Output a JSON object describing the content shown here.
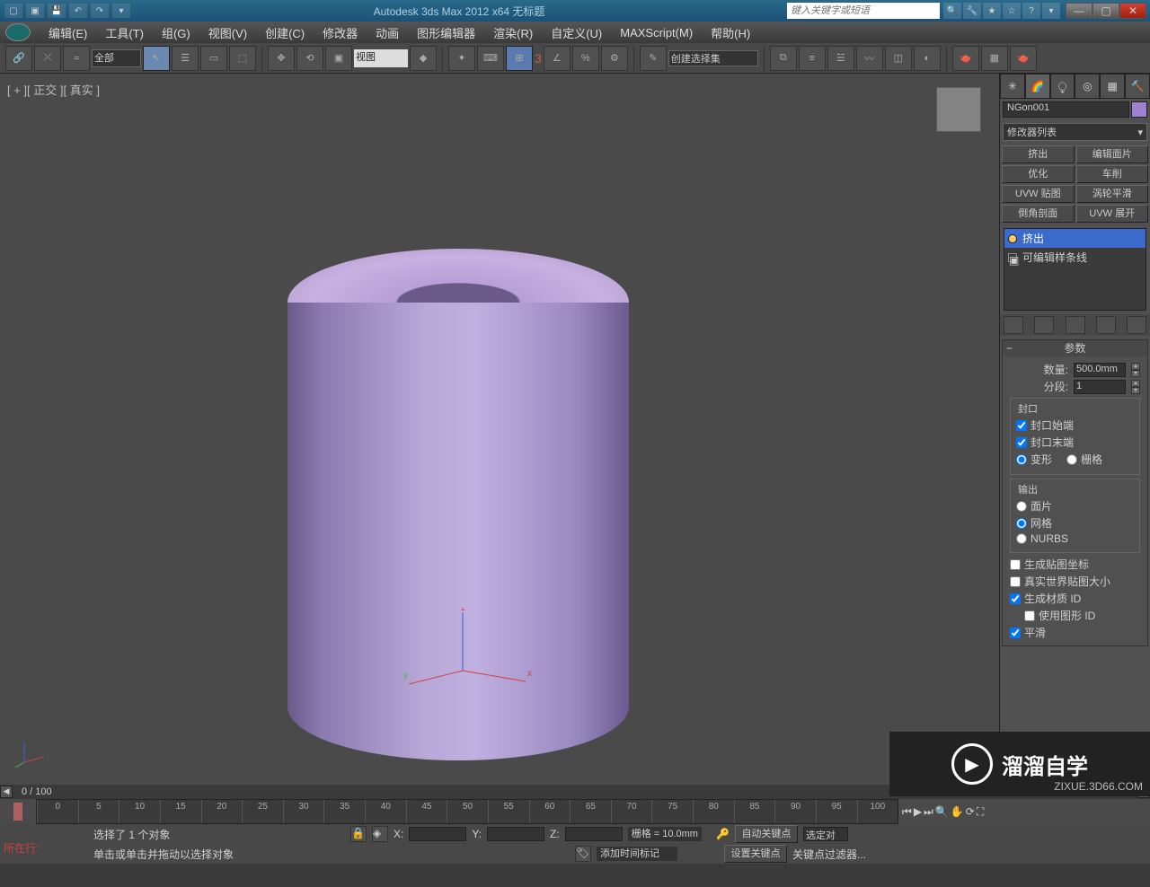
{
  "titlebar": {
    "title": "Autodesk 3ds Max  2012 x64     无标题",
    "search_placeholder": "键入关键字或短语"
  },
  "menus": [
    "编辑(E)",
    "工具(T)",
    "组(G)",
    "视图(V)",
    "创建(C)",
    "修改器",
    "动画",
    "图形编辑器",
    "渲染(R)",
    "自定义(U)",
    "MAXScript(M)",
    "帮助(H)"
  ],
  "toolbar": {
    "sel_filter": "全部",
    "view_dd": "视图",
    "snap_label": "3",
    "named_sel": "创建选择集"
  },
  "viewport": {
    "label": "[ + ][ 正交 ][ 真实 ]",
    "axes": {
      "x": "x",
      "y": "y",
      "z": "z"
    }
  },
  "cmdpanel": {
    "obj_name": "NGon001",
    "mod_list_label": "修改器列表",
    "mod_buttons": [
      "挤出",
      "编辑面片",
      "优化",
      "车削",
      "UVW 贴图",
      "涡轮平滑",
      "倒角剖面",
      "UVW 展开"
    ],
    "stack": {
      "item1": "挤出",
      "item2": "可编辑样条线"
    },
    "rollout": {
      "title": "参数",
      "amount_label": "数量:",
      "amount_value": "500.0mm",
      "segs_label": "分段:",
      "segs_value": "1",
      "cap_group": "封口",
      "cap_start": "封口始端",
      "cap_end": "封口末端",
      "morph": "变形",
      "grid": "栅格",
      "output_group": "输出",
      "patch": "面片",
      "mesh": "网格",
      "nurbs": "NURBS",
      "gen_map": "生成贴图坐标",
      "real_world": "真实世界贴图大小",
      "gen_matid": "生成材质 ID",
      "use_shapeid": "使用图形 ID",
      "smooth": "平滑"
    }
  },
  "bottom": {
    "frame": "0 / 100",
    "ticks": [
      "0",
      "5",
      "10",
      "15",
      "20",
      "25",
      "30",
      "35",
      "40",
      "45",
      "50",
      "55",
      "60",
      "65",
      "70",
      "75",
      "80",
      "85",
      "90",
      "95",
      "100"
    ],
    "status1": "选择了 1 个对象",
    "status2": "单击或单击并拖动以选择对象",
    "x_label": "X:",
    "y_label": "Y:",
    "z_label": "Z:",
    "grid_label": "栅格 = 10.0mm",
    "addtime": "添加时间标记",
    "autokey": "自动关键点",
    "selset": "选定对",
    "setkey": "设置关键点",
    "keyfilter": "关键点过滤器...",
    "now_row": "所在行:"
  },
  "watermark": {
    "text": "溜溜自学",
    "url": "ZIXUE.3D66.COM"
  }
}
